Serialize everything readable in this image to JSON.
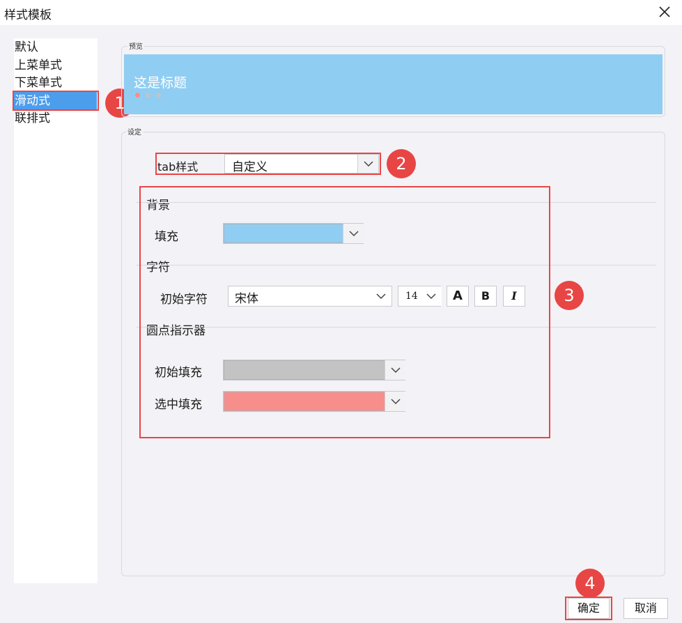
{
  "window": {
    "title": "样式模板"
  },
  "sidebar": {
    "items": [
      {
        "label": "默认"
      },
      {
        "label": "上菜单式"
      },
      {
        "label": "下菜单式"
      },
      {
        "label": "滑动式",
        "selected": true
      },
      {
        "label": "联排式"
      }
    ]
  },
  "preview": {
    "group_label": "预览",
    "title_text": "这是标题"
  },
  "settings": {
    "group_label": "设定",
    "tab_style": {
      "label": "tab样式",
      "value": "自定义"
    },
    "background": {
      "section_label": "背景",
      "fill_label": "填充",
      "fill_color": "#90cdf2"
    },
    "character": {
      "section_label": "字符",
      "initial_label": "初始字符",
      "font": "宋体",
      "size": "14",
      "buttons": {
        "font_color": "A",
        "bold": "B",
        "italic": "I"
      }
    },
    "dot_indicator": {
      "section_label": "圆点指示器",
      "initial_fill_label": "初始填充",
      "initial_fill_color": "#c3c3c3",
      "selected_fill_label": "选中填充",
      "selected_fill_color": "#f88e8b"
    }
  },
  "annotations": [
    "1",
    "2",
    "3",
    "4"
  ],
  "footer": {
    "ok_label": "确定",
    "cancel_label": "取消"
  },
  "colors": {
    "accent": "#4d9ded",
    "highlight": "#e84545",
    "preview_bg": "#90cdf2"
  }
}
